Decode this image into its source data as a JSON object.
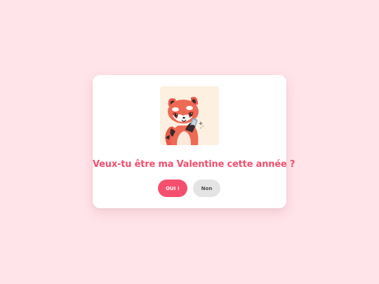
{
  "dialog": {
    "question": "Veux-tu être ma Valentine cette année ?",
    "yes_label": "OUI !",
    "no_label": "Non",
    "illustration_icon": "red-panda-phone-illustration"
  },
  "colors": {
    "background": "#ffe4e9",
    "accent": "#f4506e",
    "question_text": "#f0506e",
    "secondary_button": "#e4e4e4",
    "illustration_bg": "#fdf0e1"
  }
}
